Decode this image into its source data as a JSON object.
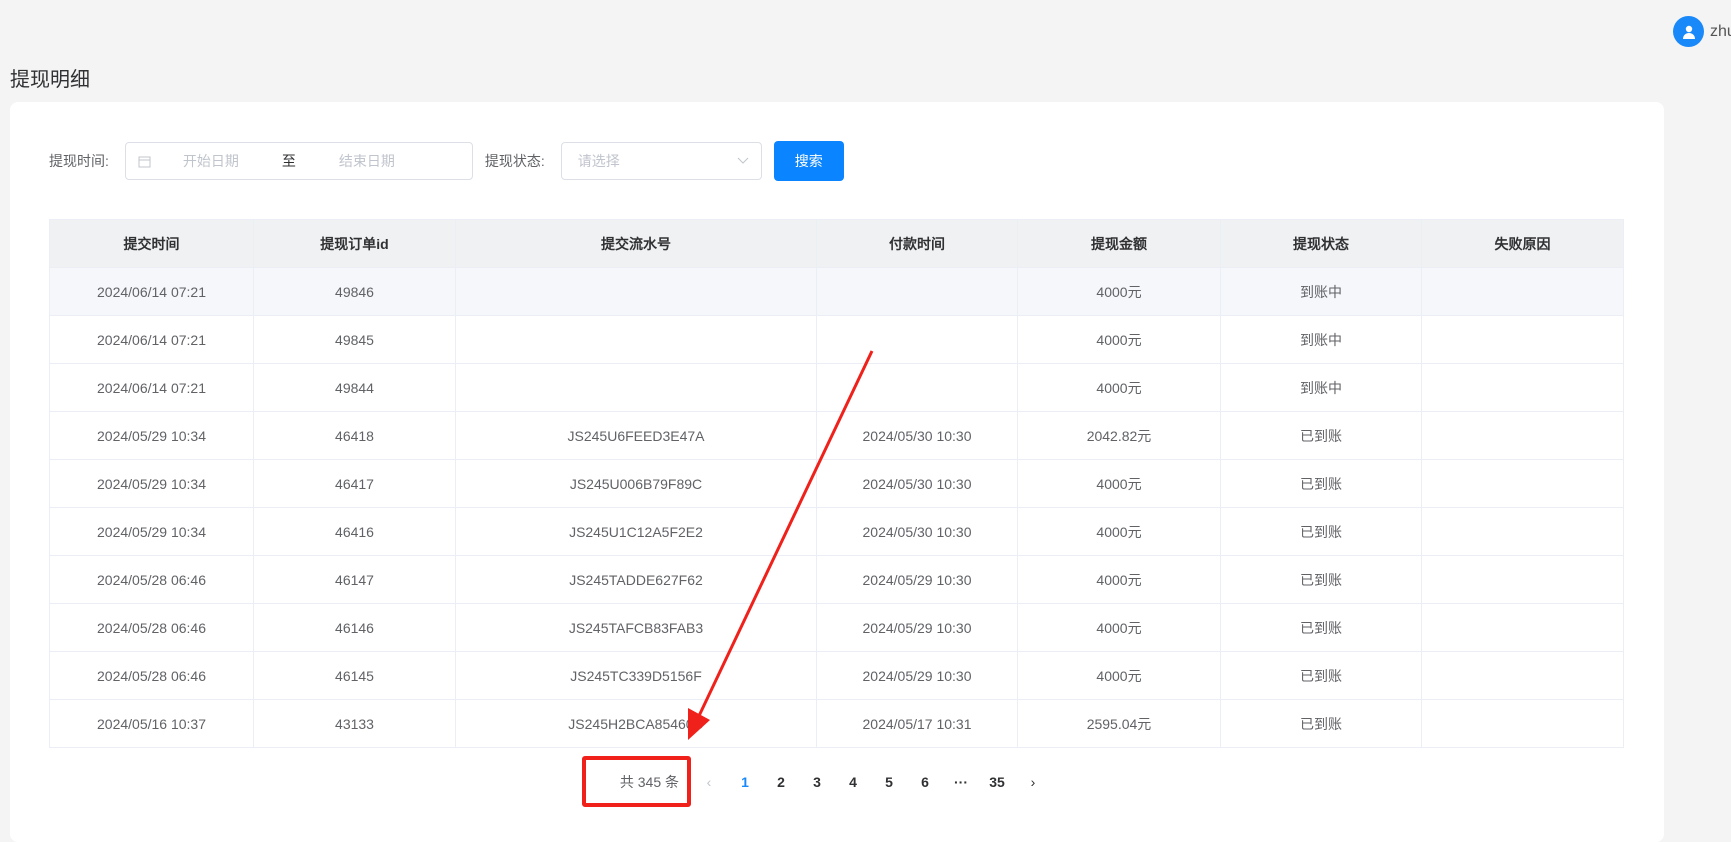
{
  "header": {
    "username": "zhu"
  },
  "page": {
    "title": "提现明细"
  },
  "filter": {
    "time_label": "提现时间:",
    "start_placeholder": "开始日期",
    "range_separator": "至",
    "end_placeholder": "结束日期",
    "status_label": "提现状态:",
    "status_placeholder": "请选择",
    "search_label": "搜索"
  },
  "table": {
    "columns": [
      "提交时间",
      "提现订单id",
      "提交流水号",
      "付款时间",
      "提现金额",
      "提现状态",
      "失败原因"
    ],
    "rows": [
      [
        "2024/06/14 07:21",
        "49846",
        "",
        "",
        "4000元",
        "到账中",
        ""
      ],
      [
        "2024/06/14 07:21",
        "49845",
        "",
        "",
        "4000元",
        "到账中",
        ""
      ],
      [
        "2024/06/14 07:21",
        "49844",
        "",
        "",
        "4000元",
        "到账中",
        ""
      ],
      [
        "2024/05/29 10:34",
        "46418",
        "JS245U6FEED3E47A",
        "2024/05/30 10:30",
        "2042.82元",
        "已到账",
        ""
      ],
      [
        "2024/05/29 10:34",
        "46417",
        "JS245U006B79F89C",
        "2024/05/30 10:30",
        "4000元",
        "已到账",
        ""
      ],
      [
        "2024/05/29 10:34",
        "46416",
        "JS245U1C12A5F2E2",
        "2024/05/30 10:30",
        "4000元",
        "已到账",
        ""
      ],
      [
        "2024/05/28 06:46",
        "46147",
        "JS245TADDE627F62",
        "2024/05/29 10:30",
        "4000元",
        "已到账",
        ""
      ],
      [
        "2024/05/28 06:46",
        "46146",
        "JS245TAFCB83FAB3",
        "2024/05/29 10:30",
        "4000元",
        "已到账",
        ""
      ],
      [
        "2024/05/28 06:46",
        "46145",
        "JS245TC339D5156F",
        "2024/05/29 10:30",
        "4000元",
        "已到账",
        ""
      ],
      [
        "2024/05/16 10:37",
        "43133",
        "JS245H2BCA85460D",
        "2024/05/17 10:31",
        "2595.04元",
        "已到账",
        ""
      ]
    ]
  },
  "pagination": {
    "total_text": "共 345 条",
    "pages": [
      "1",
      "2",
      "3",
      "4",
      "5",
      "6",
      "···",
      "35"
    ],
    "current": "1"
  },
  "colors": {
    "accent": "#1989fa",
    "button": "#0a84ff",
    "annotation": "#f0201a"
  }
}
